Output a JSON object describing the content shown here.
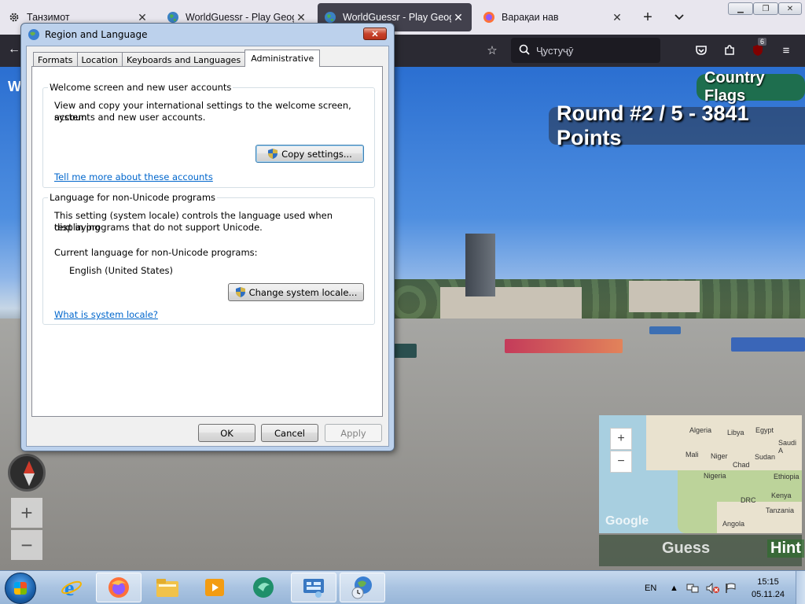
{
  "browser": {
    "tabs": [
      {
        "title": "Танзимот",
        "icon": "gear-icon"
      },
      {
        "title": "WorldGuessr - Play Geoguessr",
        "icon": "globe-icon"
      },
      {
        "title": "WorldGuessr - Play Geoguessr",
        "icon": "globe-icon",
        "active": true
      },
      {
        "title": "Варақаи нав",
        "icon": "firefox-icon"
      }
    ],
    "search_placeholder": "Ҷустуҷӯ",
    "extension_badge": "6",
    "window_buttons": [
      "minimize",
      "restore",
      "close"
    ]
  },
  "game": {
    "mode_badge": "Country Flags",
    "round_text": "Round #2 / 5 - 3841 Points",
    "left_overlay_text": "W",
    "zoom_in": "+",
    "zoom_out": "−",
    "map": {
      "zoom_in": "+",
      "zoom_out": "−",
      "labels": [
        "Algeria",
        "Libya",
        "Egypt",
        "Saudi A",
        "Mali",
        "Niger",
        "Sudan",
        "Chad",
        "Nigeria",
        "Ethiopia",
        "DRC",
        "Kenya",
        "Tanzania",
        "Angola"
      ],
      "logo": "Google"
    },
    "guess_label": "Guess",
    "hint_label": "Hint"
  },
  "dialog": {
    "title": "Region and Language",
    "close_label": "✕",
    "tabs": [
      "Formats",
      "Location",
      "Keyboards and Languages",
      "Administrative"
    ],
    "active_tab": "Administrative",
    "welcome_group": {
      "legend": "Welcome screen and new user accounts",
      "desc_line1": "View and copy your international settings to the welcome screen, system",
      "desc_line2": "accounts and new user accounts.",
      "button": "Copy settings...",
      "link": "Tell me more about these accounts"
    },
    "unicode_group": {
      "legend": "Language for non-Unicode programs",
      "desc_line1": "This setting (system locale) controls the language used when displaying",
      "desc_line2": "text in programs that do not support Unicode.",
      "current_label": "Current language for non-Unicode programs:",
      "current_value": "English (United States)",
      "button": "Change system locale...",
      "link": "What is system locale?"
    },
    "ok": "OK",
    "cancel": "Cancel",
    "apply": "Apply"
  },
  "taskbar": {
    "language": "EN",
    "time": "15:15",
    "date": "05.11.24",
    "apps": [
      "internet-explorer-icon",
      "firefox-icon",
      "file-explorer-icon",
      "media-player-icon",
      "app-icon",
      "control-panel-icon",
      "region-language-icon"
    ]
  },
  "colors": {
    "firefox_toolbar": "#2b2a33",
    "tab_strip": "#e8e6ee",
    "link_blue": "#0066cc",
    "mode_badge_green": "#1e6e4e"
  }
}
